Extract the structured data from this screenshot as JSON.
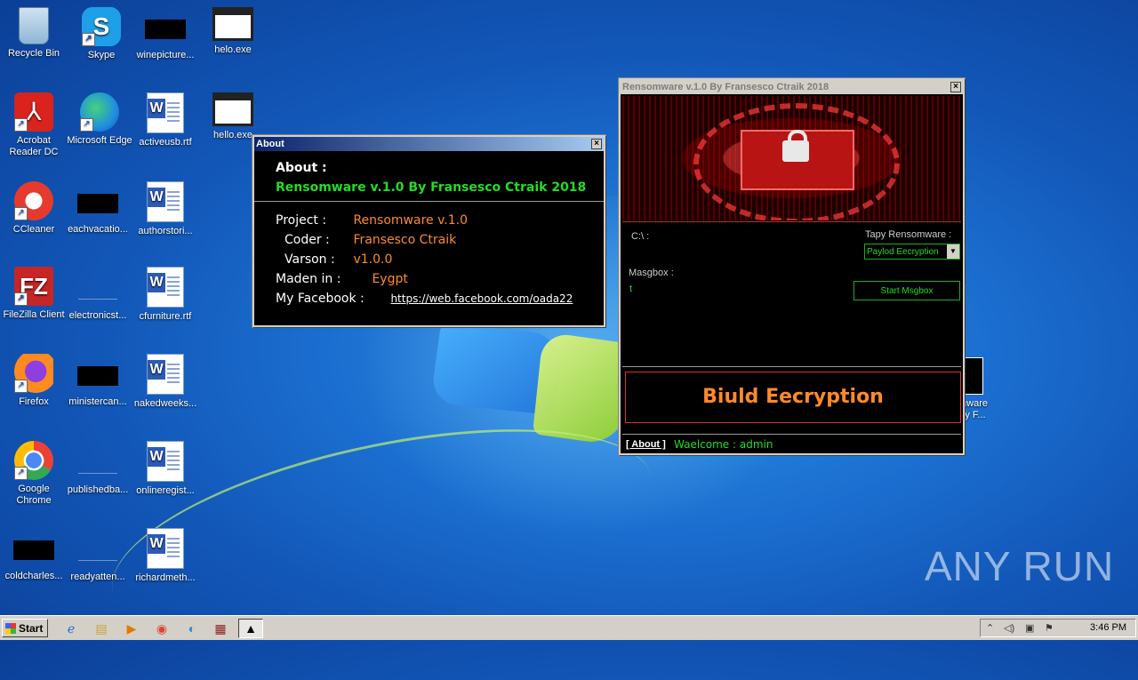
{
  "desktop_icons": [
    {
      "label": "Recycle Bin"
    },
    {
      "label": "Skype"
    },
    {
      "label": "winepicture..."
    },
    {
      "label": "helo.exe"
    },
    {
      "label": "Acrobat Reader DC"
    },
    {
      "label": "Microsoft Edge"
    },
    {
      "label": "activeusb.rtf"
    },
    {
      "label": "hello.exe"
    },
    {
      "label": "CCleaner"
    },
    {
      "label": "eachvacatio..."
    },
    {
      "label": "authorstori..."
    },
    {
      "label": "FileZilla Client"
    },
    {
      "label": "electronicst..."
    },
    {
      "label": "cfurniture.rtf"
    },
    {
      "label": "Firefox"
    },
    {
      "label": "ministercan..."
    },
    {
      "label": "nakedweeks..."
    },
    {
      "label": "Google Chrome"
    },
    {
      "label": "publishedba..."
    },
    {
      "label": "onlineregist..."
    },
    {
      "label": "coldcharles..."
    },
    {
      "label": "readyatten..."
    },
    {
      "label": "richardmeth..."
    },
    {
      "label": "mware By F..."
    }
  ],
  "about_window": {
    "title": "About",
    "heading": "About :",
    "product_line": "Rensomware v.1.0 By Fransesco Ctraik 2018",
    "rows": [
      {
        "label": "Project :",
        "value": "Rensomware v.1.0"
      },
      {
        "label": "Coder :",
        "value": "Fransesco Ctraik"
      },
      {
        "label": "Varson :",
        "value": "v1.0.0"
      },
      {
        "label": "Maden in :",
        "value": "Eygpt"
      },
      {
        "label": "My Facebook :",
        "value": "https://web.facebook.com/oada22"
      }
    ]
  },
  "ransom_window": {
    "title": "Rensomware v.1.0 By Fransesco Ctraik 2018",
    "path_label": "C:\\ :",
    "type_label": "Tapy Rensomware :",
    "type_value": "Paylod Eecryption",
    "msgbox_label": "Masgbox :",
    "msgbox_value": "t",
    "start_button": "Start Msgbox",
    "build_button": "Biuld Eecryption",
    "about_link": "[ About ]",
    "welcome": "Waelcome : admin"
  },
  "taskbar": {
    "start_label": "Start",
    "clock": "3:46 PM"
  },
  "watermark": "ANY RUN"
}
